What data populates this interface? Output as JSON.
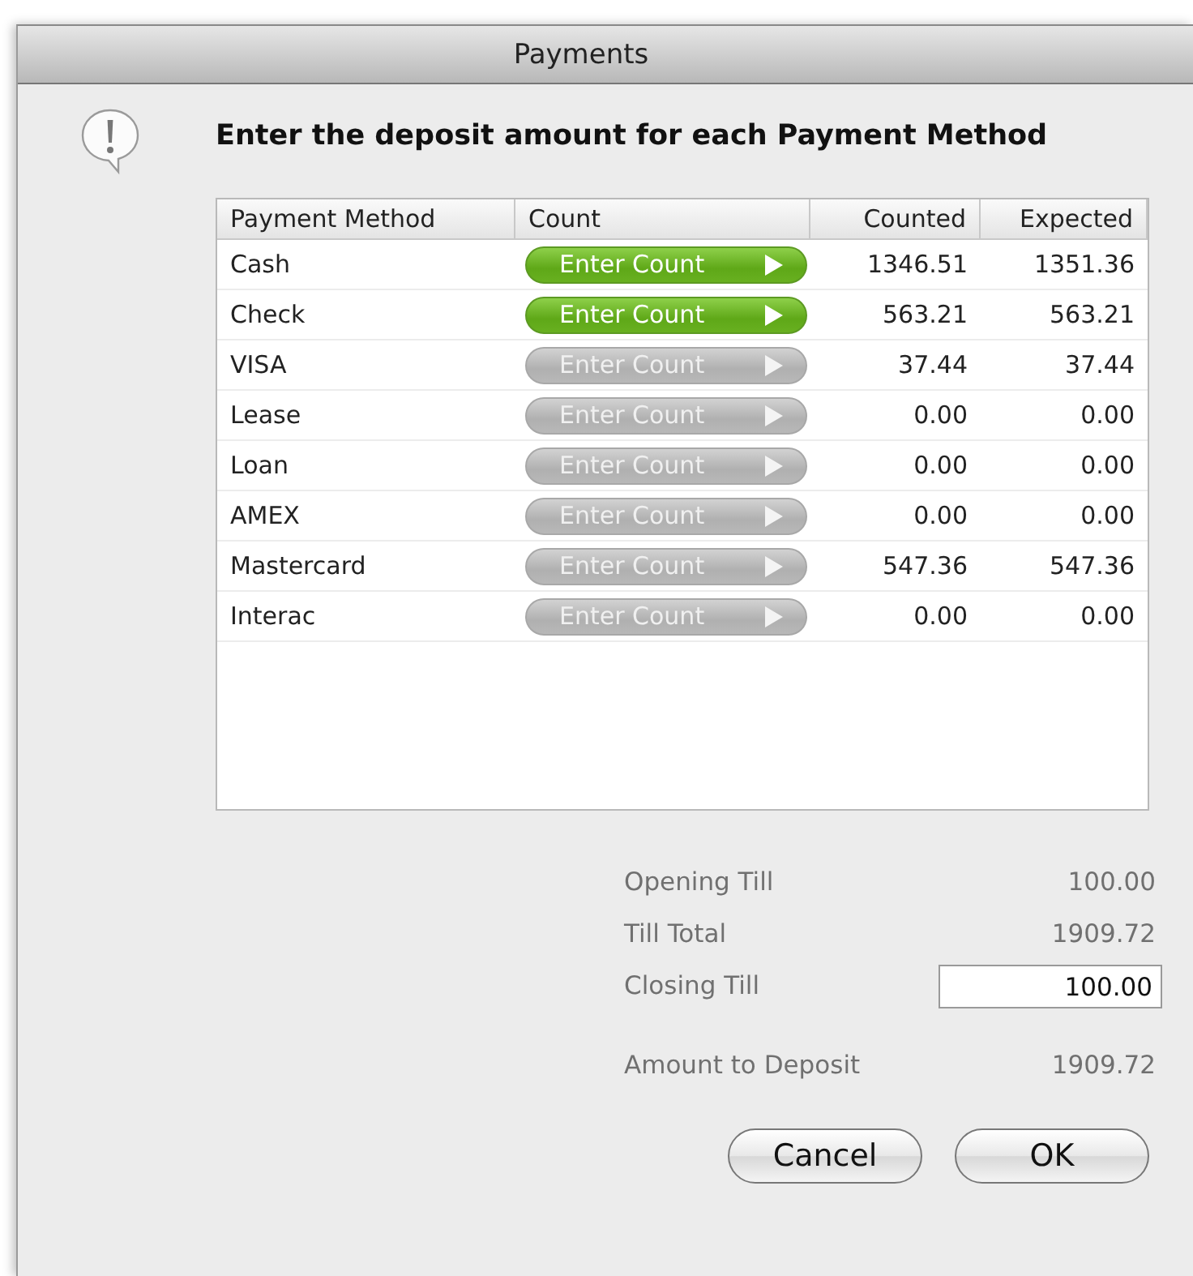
{
  "window": {
    "title": "Payments"
  },
  "message": "Enter the deposit amount for each Payment Method",
  "table": {
    "columns": [
      "Payment Method",
      "Count",
      "Counted",
      "Expected"
    ],
    "rows": [
      {
        "method": "Cash",
        "button": "Enter Count",
        "disabled": false,
        "counted": "1346.51",
        "expected": "1351.36"
      },
      {
        "method": "Check",
        "button": "Enter Count",
        "disabled": false,
        "counted": "563.21",
        "expected": "563.21"
      },
      {
        "method": "VISA",
        "button": "Enter Count",
        "disabled": true,
        "counted": "37.44",
        "expected": "37.44"
      },
      {
        "method": "Lease",
        "button": "Enter Count",
        "disabled": true,
        "counted": "0.00",
        "expected": "0.00"
      },
      {
        "method": "Loan",
        "button": "Enter Count",
        "disabled": true,
        "counted": "0.00",
        "expected": "0.00"
      },
      {
        "method": "AMEX",
        "button": "Enter Count",
        "disabled": true,
        "counted": "0.00",
        "expected": "0.00"
      },
      {
        "method": "Mastercard",
        "button": "Enter Count",
        "disabled": true,
        "counted": "547.36",
        "expected": "547.36"
      },
      {
        "method": "Interac",
        "button": "Enter Count",
        "disabled": true,
        "counted": "0.00",
        "expected": "0.00"
      }
    ]
  },
  "summary": [
    {
      "kind": "text",
      "label": "Opening Till",
      "value": "100.00"
    },
    {
      "kind": "text",
      "label": "Till Total",
      "value": "1909.72"
    },
    {
      "kind": "field",
      "label": "Closing Till",
      "value": "100.00"
    },
    {
      "kind": "text",
      "label": "Amount to Deposit",
      "value": "1909.72"
    }
  ],
  "buttons": [
    "Cancel",
    "OK"
  ]
}
